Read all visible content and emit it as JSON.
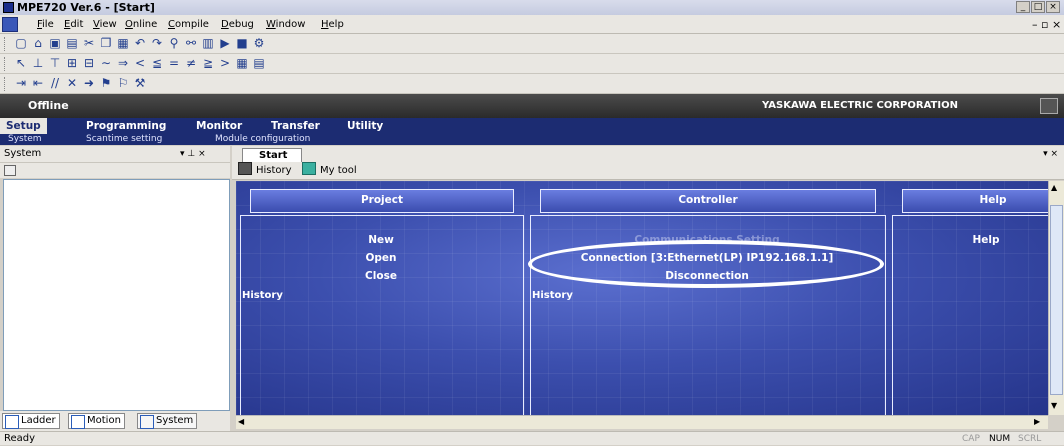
{
  "window": {
    "title": "MPE720 Ver.6 - [Start]",
    "controls": [
      "_",
      "□",
      "×"
    ],
    "doc_controls": [
      "–",
      "▫",
      "×"
    ]
  },
  "menu": [
    "File",
    "Edit",
    "View",
    "Online",
    "Compile",
    "Debug",
    "Window",
    "Help"
  ],
  "band": {
    "status": "Offline",
    "company": "YASKAWA ELECTRIC CORPORATION"
  },
  "tabs": [
    "Setup",
    "Programming",
    "Monitor",
    "Transfer",
    "Utility"
  ],
  "subtabs": [
    "System",
    "Scantime setting",
    "Module configuration"
  ],
  "system_panel": {
    "title": "System",
    "controls": "▾ ⊥ ×",
    "bottom_tabs": [
      "Ladder",
      "Motion",
      "System"
    ]
  },
  "doc": {
    "tab": "Start",
    "close": "▾ ×",
    "history_button": "History",
    "mytool_button": "My tool"
  },
  "project": {
    "header": "Project",
    "items": [
      "New",
      "Open",
      "Close"
    ],
    "history": "History"
  },
  "controller": {
    "header": "Controller",
    "items": [
      "Communications Setting",
      "Connection [3:Ethernet(LP) IP192.168.1.1]",
      "Disconnection"
    ],
    "history": "History"
  },
  "help": {
    "header": "Help",
    "items": [
      "Help"
    ]
  },
  "status": {
    "left": "Ready",
    "indicators": [
      "CAP",
      "NUM",
      "SCRL"
    ]
  }
}
